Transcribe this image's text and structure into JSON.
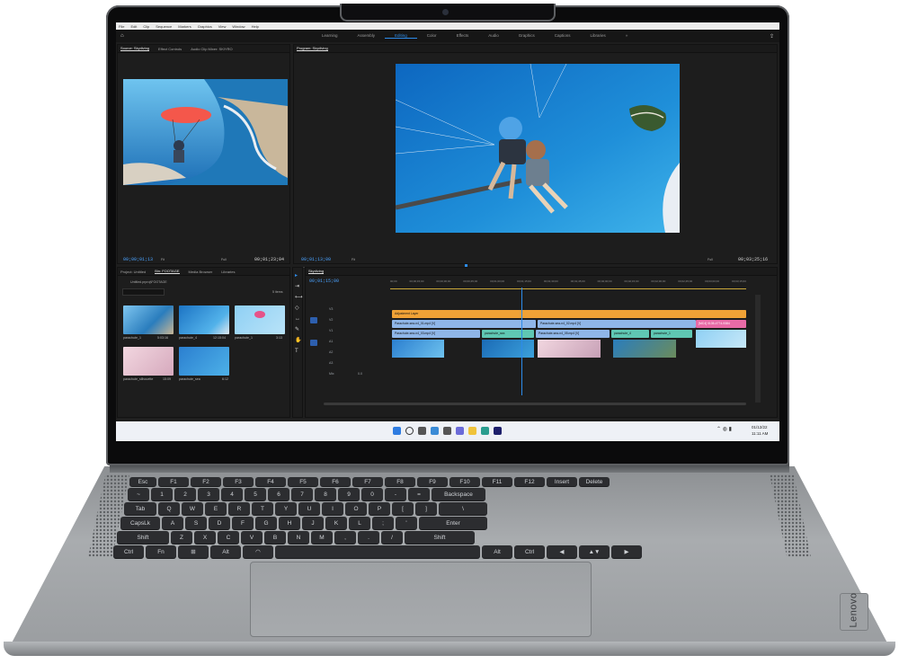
{
  "brand": "Lenovo",
  "app": {
    "menu": [
      "File",
      "Edit",
      "Clip",
      "Sequence",
      "Markers",
      "Graphics",
      "View",
      "Window",
      "Help"
    ],
    "workspaces": [
      "Learning",
      "Assembly",
      "Editing",
      "Color",
      "Effects",
      "Audio",
      "Graphics",
      "Captions",
      "Libraries"
    ],
    "active_workspace": "Editing",
    "source_panel": {
      "tabs": [
        "Source: Skydiving",
        "Effect Controls",
        "Audio Clip Mixer: SKIYRO"
      ],
      "timecode_in": "00;00;01;13",
      "fit": "Fit",
      "full": "Full",
      "timecode_out": "00;01;23;04"
    },
    "program_panel": {
      "tab": "Program: Skydiving",
      "timecode_in": "00;01;13;00",
      "fit": "Fit",
      "full": "Full",
      "timecode_out": "00;03;25;16"
    },
    "project_panel": {
      "tabs": [
        "Project: Untitled",
        "Bin: FOOTAGE",
        "Media Browser",
        "Libraries"
      ],
      "path": "Untitled.prproj\\FOOTAGE",
      "count": "5 items",
      "clips": [
        {
          "name": "parachute_1",
          "duration": "5:03:16"
        },
        {
          "name": "parachute_4",
          "duration": "12:15:04"
        },
        {
          "name": "parachute_1",
          "duration": "3:13"
        },
        {
          "name": "parachute_silhouette",
          "duration": "15:09"
        },
        {
          "name": "parachute_sea",
          "duration": "6:12"
        }
      ]
    },
    "timeline": {
      "tab": "Skydiving",
      "timecode": "00;01;15;00",
      "ruler": [
        "00;00",
        "00;00;15;00",
        "00;00;30;00",
        "00;00;45;00",
        "00;01;00;00",
        "00;01;15;00",
        "00;01;30;00",
        "00;01;45;00",
        "00;02;00;00",
        "00;02;15;00",
        "00;02;30;00",
        "00;02;45;00",
        "00;03;00;00",
        "00;03;15;00"
      ],
      "tracks": [
        "V3",
        "V2",
        "V1",
        "A1",
        "A2",
        "A3",
        "Mix"
      ],
      "adjustment_layer": "Adjustment Layer",
      "clip_v2a": "Parachute-sea-n4_01.mp4 [V]",
      "clip_v2b": "Parachute-sea-n4_02.mp4 [V]",
      "clip_v1a": "Parachute-sea-n4_03.mp4 [V]",
      "clip_v1b": "parachute_sea",
      "clip_v1c": "Parachute-sea-n4_05.mp4 [V]",
      "clip_v1d": "parachute_4",
      "clip_v1e": "parachute_1",
      "clip_v1f": "[MC4] 0135-4774-9384",
      "mix_value": "0.0"
    },
    "taskbar": {
      "time": "01/12/22",
      "date": "11:11 AM"
    }
  },
  "colors": {
    "accent_blue": "#2d8ceb",
    "adjustment": "#f0a236",
    "video_clip": "#8fb6e8",
    "audio_clip": "#5fc7b3",
    "pink_clip": "#e86aa6"
  }
}
